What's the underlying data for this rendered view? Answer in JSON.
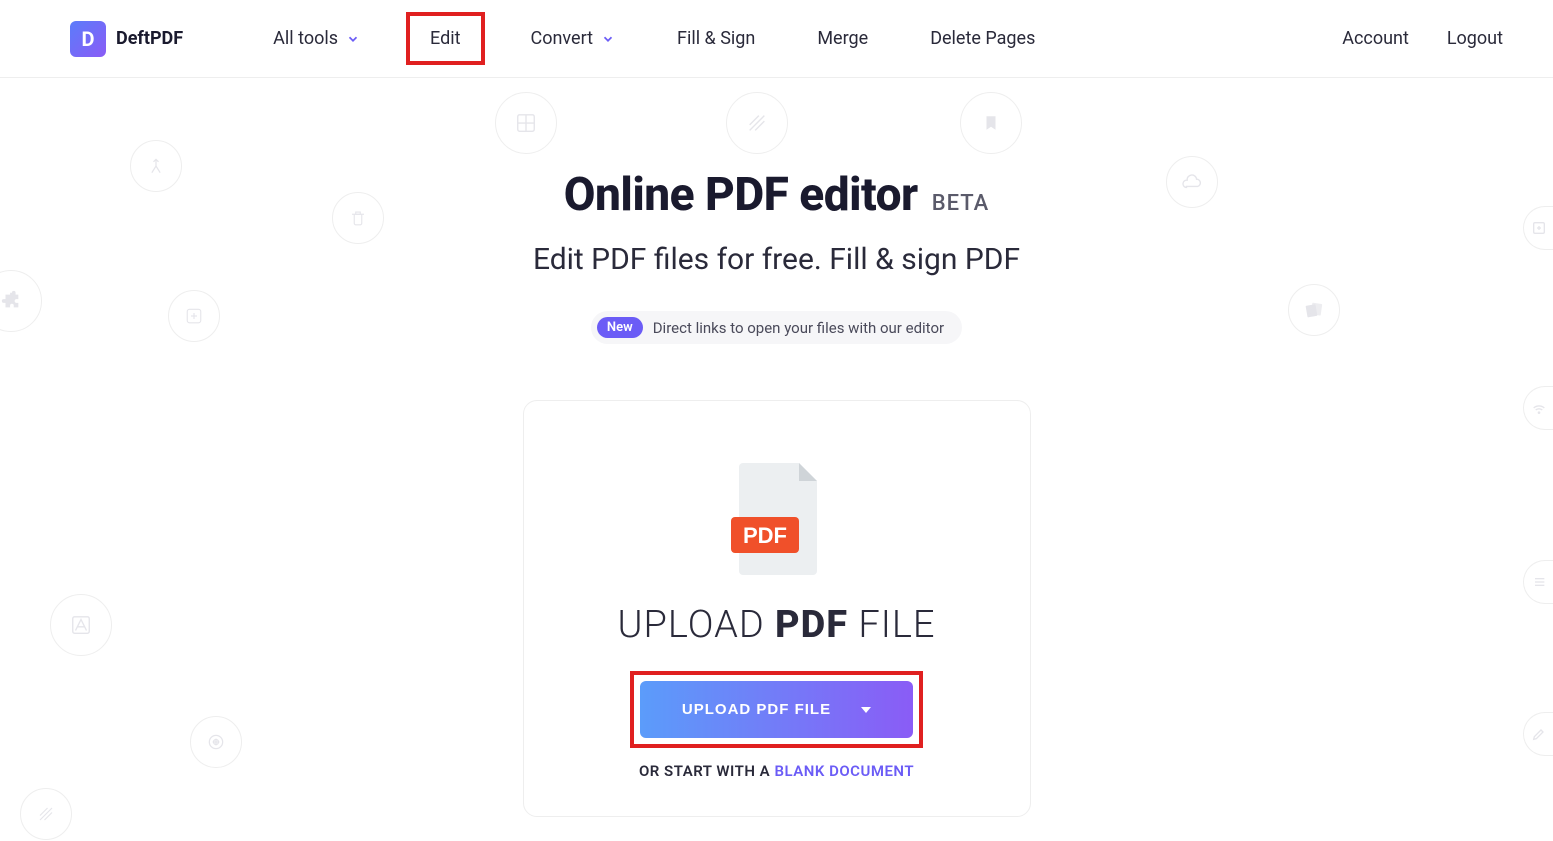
{
  "brand": {
    "name": "DeftPDF",
    "logo_letter": "D"
  },
  "nav": {
    "all_tools": "All tools",
    "edit": "Edit",
    "convert": "Convert",
    "fill_sign": "Fill & Sign",
    "merge": "Merge",
    "delete_pages": "Delete Pages",
    "account": "Account",
    "logout": "Logout"
  },
  "hero": {
    "title": "Online PDF editor",
    "beta": "BETA",
    "subtitle": "Edit PDF files for free. Fill & sign PDF",
    "new_pill": "New",
    "new_text": "Direct links to open your files with our editor"
  },
  "upload": {
    "title_pre": "UPLOAD ",
    "title_strong": "PDF",
    "title_post": " FILE",
    "button": "UPLOAD PDF FILE",
    "blank_pre": "OR START WITH A ",
    "blank_link": "BLANK DOCUMENT",
    "pdf_badge": "PDF"
  }
}
